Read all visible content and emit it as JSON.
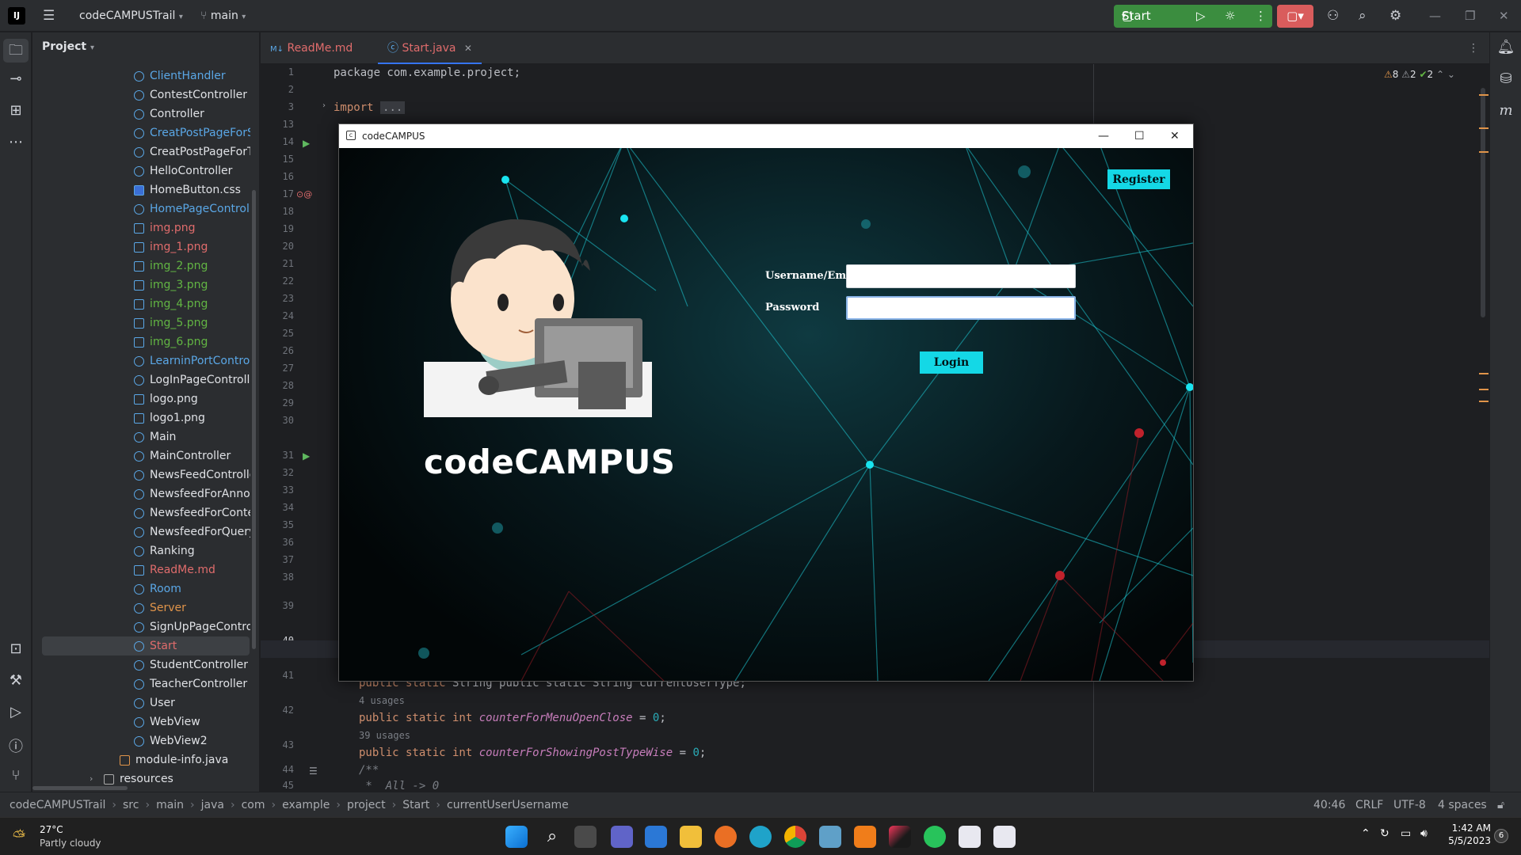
{
  "ide": {
    "project_name": "codeCAMPUSTrail",
    "branch": "main",
    "run_config": "Start",
    "panel_title": "Project",
    "tabs": [
      {
        "label": "ReadMe.md",
        "prefix": "M↓"
      },
      {
        "label": "Start.java"
      }
    ],
    "inspections": {
      "warnings": "8",
      "weak": "2",
      "ok": "2"
    }
  },
  "project_tree": [
    {
      "label": "ClientHandler",
      "color": "#5aa7e6"
    },
    {
      "label": "ContestController",
      "color": "#dfe1e5"
    },
    {
      "label": "Controller",
      "color": "#dfe1e5"
    },
    {
      "label": "CreatPostPageForStud",
      "color": "#5aa7e6"
    },
    {
      "label": "CreatPostPageForTeac",
      "color": "#dfe1e5"
    },
    {
      "label": "HelloController",
      "color": "#dfe1e5"
    },
    {
      "label": "HomeButton.css",
      "color": "#dfe1e5"
    },
    {
      "label": "HomePageController",
      "color": "#5aa7e6"
    },
    {
      "label": "img.png",
      "color": "#e06c6c"
    },
    {
      "label": "img_1.png",
      "color": "#e06c6c"
    },
    {
      "label": "img_2.png",
      "color": "#62b543"
    },
    {
      "label": "img_3.png",
      "color": "#62b543"
    },
    {
      "label": "img_4.png",
      "color": "#62b543"
    },
    {
      "label": "img_5.png",
      "color": "#62b543"
    },
    {
      "label": "img_6.png",
      "color": "#62b543"
    },
    {
      "label": "LearninPortController",
      "color": "#5aa7e6"
    },
    {
      "label": "LogInPageController",
      "color": "#dfe1e5"
    },
    {
      "label": "logo.png",
      "color": "#dfe1e5"
    },
    {
      "label": "logo1.png",
      "color": "#dfe1e5"
    },
    {
      "label": "Main",
      "color": "#dfe1e5"
    },
    {
      "label": "MainController",
      "color": "#dfe1e5"
    },
    {
      "label": "NewsFeedController",
      "color": "#dfe1e5"
    },
    {
      "label": "NewsfeedForAnnounc",
      "color": "#dfe1e5"
    },
    {
      "label": "NewsfeedForContest/",
      "color": "#dfe1e5"
    },
    {
      "label": "NewsfeedForQueryCo",
      "color": "#dfe1e5"
    },
    {
      "label": "Ranking",
      "color": "#dfe1e5"
    },
    {
      "label": "ReadMe.md",
      "color": "#e06c6c"
    },
    {
      "label": "Room",
      "color": "#5aa7e6"
    },
    {
      "label": "Server",
      "color": "#e0944a"
    },
    {
      "label": "SignUpPageController",
      "color": "#dfe1e5"
    },
    {
      "label": "Start",
      "color": "#e06c6c"
    },
    {
      "label": "StudentController",
      "color": "#dfe1e5"
    },
    {
      "label": "TeacherController",
      "color": "#dfe1e5"
    },
    {
      "label": "User",
      "color": "#dfe1e5"
    },
    {
      "label": "WebView",
      "color": "#dfe1e5"
    },
    {
      "label": "WebView2",
      "color": "#dfe1e5"
    },
    {
      "label": "module-info.java",
      "color": "#dfe1e5"
    },
    {
      "label": "resources",
      "color": "#dfe1e5"
    }
  ],
  "line_numbers": [
    "1",
    "2",
    "3",
    "13",
    "14",
    "15",
    "16",
    "17",
    "18",
    "19",
    "20",
    "21",
    "22",
    "23",
    "24",
    "25",
    "26",
    "27",
    "28",
    "29",
    "30",
    "31",
    "32",
    "33",
    "34",
    "35",
    "36",
    "37",
    "38",
    "39",
    "40",
    "41",
    "42",
    "43",
    "44",
    "45"
  ],
  "code": {
    "line1": "package com.example.project;",
    "line3_kw": "import",
    "line3_fold": "...",
    "line41": "public static String currentUserType;",
    "usages1": "4 usages",
    "line42_a": "public static int ",
    "line42_f": "counterForMenuOpenClose",
    "line42_b": " = ",
    "line42_n": "0",
    "usages2": "39 usages",
    "line43_a": "public static int ",
    "line43_f": "counterForShowingPostTypeWise",
    "line43_b": " = ",
    "line43_n": "0",
    "line44": "/**",
    "line45": " *  All -> 0"
  },
  "dialog": {
    "title": "codeCAMPUS",
    "register": "Register",
    "username_label": "Username/Email",
    "password_label": "Password",
    "username_value": "",
    "password_value": "",
    "login": "Login",
    "brand": "codeCAMPUS"
  },
  "statusbar": {
    "crumbs": [
      "codeCAMPUSTrail",
      "src",
      "main",
      "java",
      "com",
      "example",
      "project",
      "Start",
      "currentUserUsername"
    ],
    "position": "40:46",
    "line_sep": "CRLF",
    "encoding": "UTF-8",
    "indent": "4 spaces"
  },
  "taskbar": {
    "temperature": "27°C",
    "weather": "Partly cloudy",
    "time": "1:42 AM",
    "date": "5/5/2023",
    "notif_count": "6"
  },
  "colors": {
    "accent_cyan": "#14d8e6",
    "run_green": "#3b8d3f",
    "stop_red": "#d95c5c"
  }
}
